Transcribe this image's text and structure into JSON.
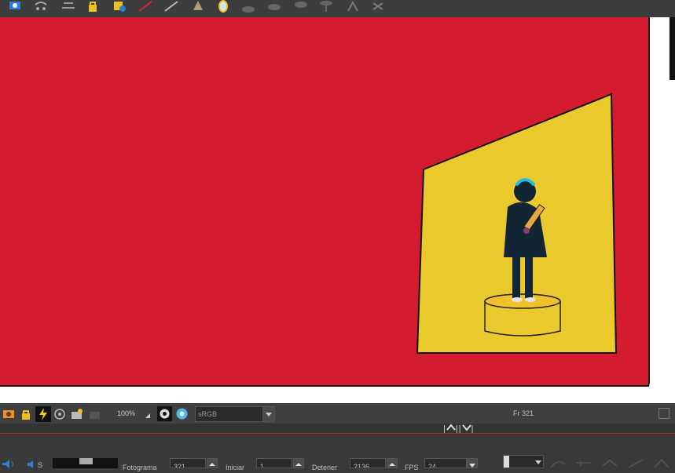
{
  "toolbar": {
    "icons": [
      "camera-view-icon",
      "peg-icon",
      "layer-icon",
      "lock-icon",
      "add-layer-icon",
      "ruler-icon",
      "grid-icon",
      "cone-icon",
      "mirror-icon",
      "ellipse-1-icon",
      "ellipse-2-icon",
      "ellipse-3-icon",
      "ellipse-4-icon",
      "bone-1-icon",
      "bone-2-icon"
    ]
  },
  "status_bar": {
    "zoom": "100%",
    "color_space": "sRGB",
    "frame_indicator": "Fr 321"
  },
  "timeline": {
    "frame_label": "Fotograma",
    "frame_value": "321",
    "start_label": "Iniciar",
    "start_value": "1",
    "stop_label": "Detener",
    "stop_value": "2136",
    "fps_label": "FPS",
    "fps_value": "24",
    "mute_label": "S"
  },
  "colors": {
    "canvas_red": "#d41c2e",
    "panel_yellow": "#eac92c",
    "accent_red": "#c0262d"
  }
}
